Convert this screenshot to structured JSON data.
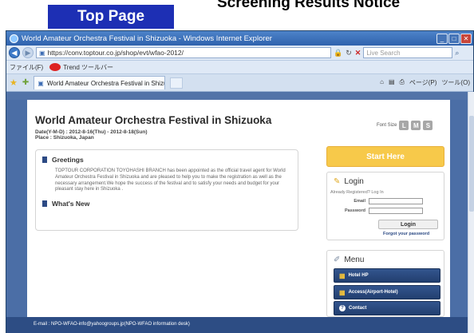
{
  "slide": {
    "top_tab": "Top Page",
    "title_cut": "Screening Results Notice"
  },
  "browser": {
    "window_title": "World Amateur Orchestra Festival in Shizuoka - Windows Internet Explorer",
    "url": "https://conv.toptour.co.jp/shop/evt/wfao-2012/",
    "search_placeholder": "Live Search",
    "menu_file": "ファイル(F)",
    "trend_toolbar": "Trend ツールバー",
    "tab_title": "World Amateur Orchestra Festival in Shizuoka",
    "cmd_page": "ページ(P)",
    "cmd_tools": "ツール(O)"
  },
  "site": {
    "title": "World Amateur Orchestra Festival in Shizuoka",
    "date": "Date(Y-M-D) : 2012-8-16(Thu) - 2012-8-18(Sun)",
    "place": "Place : Shizuoka, Japan",
    "font_size_label": "Font Size",
    "font_sizes": [
      "L",
      "M",
      "S"
    ]
  },
  "main": {
    "greetings_head": "Greetings",
    "greetings_text": "TOPTOUR CORPORATION TOYOHASHI BRANCH has been appointed as the official travel agent for World Amateur Orchestra Festival in Shizuoka and are pleased to help you to make the registration as well as the necessary arrangement.We hope the success of the festival and to satisfy your needs and budget for your pleasant stay here in Shizuoka .",
    "whats_new_head": "What's New"
  },
  "sidebar": {
    "start_here": "Start Here",
    "login_title": "Login",
    "already": "Already Registered? Log In",
    "email_label": "Email",
    "password_label": "Password",
    "login_button": "Login",
    "forgot": "Forgot your password",
    "menu_title": "Menu",
    "menu_items": [
      "Hotel HP",
      "Access(Airport-Hotel)",
      "Contact"
    ]
  },
  "footer": {
    "email_line": "E-mail : NPO-WFAO-info@yahoogroups.jp(NPO-WFAO information desk)"
  }
}
